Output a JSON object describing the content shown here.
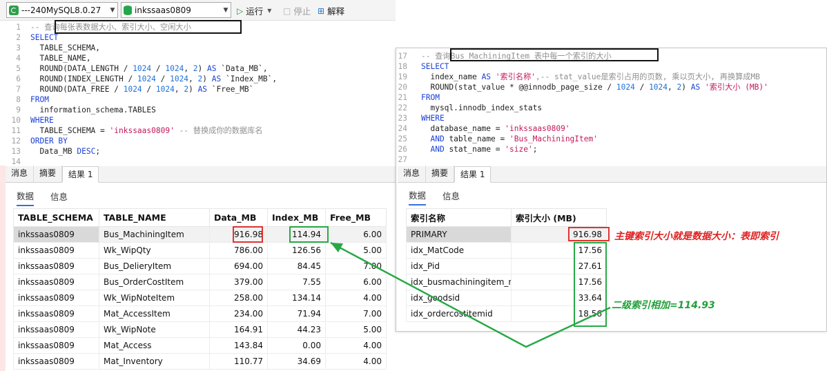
{
  "toolbar": {
    "connection": "---240MySQL8.0.27",
    "database": "inkssaas0809",
    "run_label": "运行",
    "stop_label": "停止",
    "explain_label": "解释"
  },
  "left_editor": {
    "lines": [
      {
        "n": "1",
        "segs": [
          {
            "t": "-- ",
            "c": "cm"
          },
          {
            "t": "查询每张表数据大小、索引大小、空闲大小",
            "c": "cm"
          }
        ]
      },
      {
        "n": "2",
        "segs": [
          {
            "t": "SELECT",
            "c": "kw"
          }
        ]
      },
      {
        "n": "3",
        "segs": [
          {
            "t": "  TABLE_SCHEMA,",
            "c": "tx"
          }
        ]
      },
      {
        "n": "4",
        "segs": [
          {
            "t": "  TABLE_NAME,",
            "c": "tx"
          }
        ]
      },
      {
        "n": "5",
        "segs": [
          {
            "t": "  ROUND(DATA_LENGTH / ",
            "c": "tx"
          },
          {
            "t": "1024",
            "c": "num"
          },
          {
            "t": " / ",
            "c": "tx"
          },
          {
            "t": "1024",
            "c": "num"
          },
          {
            "t": ", ",
            "c": "tx"
          },
          {
            "t": "2",
            "c": "num"
          },
          {
            "t": ") ",
            "c": "tx"
          },
          {
            "t": "AS",
            "c": "kw"
          },
          {
            "t": " `Data_MB`,",
            "c": "tx"
          }
        ]
      },
      {
        "n": "6",
        "segs": [
          {
            "t": "  ROUND(INDEX_LENGTH / ",
            "c": "tx"
          },
          {
            "t": "1024",
            "c": "num"
          },
          {
            "t": " / ",
            "c": "tx"
          },
          {
            "t": "1024",
            "c": "num"
          },
          {
            "t": ", ",
            "c": "tx"
          },
          {
            "t": "2",
            "c": "num"
          },
          {
            "t": ") ",
            "c": "tx"
          },
          {
            "t": "AS",
            "c": "kw"
          },
          {
            "t": " `Index_MB`,",
            "c": "tx"
          }
        ]
      },
      {
        "n": "7",
        "segs": [
          {
            "t": "  ROUND(DATA_FREE / ",
            "c": "tx"
          },
          {
            "t": "1024",
            "c": "num"
          },
          {
            "t": " / ",
            "c": "tx"
          },
          {
            "t": "1024",
            "c": "num"
          },
          {
            "t": ", ",
            "c": "tx"
          },
          {
            "t": "2",
            "c": "num"
          },
          {
            "t": ") ",
            "c": "tx"
          },
          {
            "t": "AS",
            "c": "kw"
          },
          {
            "t": " `Free_MB`",
            "c": "tx"
          }
        ]
      },
      {
        "n": "8",
        "segs": [
          {
            "t": "FROM",
            "c": "kw"
          }
        ]
      },
      {
        "n": "9",
        "segs": [
          {
            "t": "  information_schema.TABLES",
            "c": "tx"
          }
        ]
      },
      {
        "n": "10",
        "segs": [
          {
            "t": "WHERE",
            "c": "kw"
          }
        ]
      },
      {
        "n": "11",
        "segs": [
          {
            "t": "  TABLE_SCHEMA = ",
            "c": "tx"
          },
          {
            "t": "'inkssaas0809'",
            "c": "str"
          },
          {
            "t": " -- 替换成你的数据库名",
            "c": "cm"
          }
        ]
      },
      {
        "n": "12",
        "segs": [
          {
            "t": "ORDER BY",
            "c": "kw"
          }
        ]
      },
      {
        "n": "13",
        "segs": [
          {
            "t": "  Data_MB ",
            "c": "tx"
          },
          {
            "t": "DESC",
            "c": "kw"
          },
          {
            "t": ";",
            "c": "tx"
          }
        ]
      },
      {
        "n": "14",
        "segs": []
      }
    ]
  },
  "left_tabs": [
    "消息",
    "摘要",
    "结果 1"
  ],
  "left_subtabs": [
    "数据",
    "信息"
  ],
  "left_table": {
    "columns": [
      "TABLE_SCHEMA",
      "TABLE_NAME",
      "Data_MB",
      "Index_MB",
      "Free_MB"
    ],
    "rows": [
      [
        "inkssaas0809",
        "Bus_MachiningItem",
        "916.98",
        "114.94",
        "6.00"
      ],
      [
        "inkssaas0809",
        "Wk_WipQty",
        "786.00",
        "126.56",
        "5.00"
      ],
      [
        "inkssaas0809",
        "Bus_DelieryItem",
        "694.00",
        "84.45",
        "7.00"
      ],
      [
        "inkssaas0809",
        "Bus_OrderCostItem",
        "379.00",
        "7.55",
        "6.00"
      ],
      [
        "inkssaas0809",
        "Wk_WipNoteItem",
        "258.00",
        "134.14",
        "4.00"
      ],
      [
        "inkssaas0809",
        "Mat_AccessItem",
        "234.00",
        "71.94",
        "7.00"
      ],
      [
        "inkssaas0809",
        "Wk_WipNote",
        "164.91",
        "44.23",
        "5.00"
      ],
      [
        "inkssaas0809",
        "Mat_Access",
        "143.84",
        "0.00",
        "4.00"
      ],
      [
        "inkssaas0809",
        "Mat_Inventory",
        "110.77",
        "34.69",
        "4.00"
      ]
    ]
  },
  "right_editor": {
    "lines": [
      {
        "n": "17",
        "segs": [
          {
            "t": "-- ",
            "c": "cm"
          },
          {
            "t": "查询Bus_MachiningItem 表中每一个索引的大小",
            "c": "cm"
          }
        ]
      },
      {
        "n": "18",
        "segs": [
          {
            "t": "SELECT",
            "c": "kw"
          }
        ]
      },
      {
        "n": "19",
        "segs": [
          {
            "t": "  index_name ",
            "c": "tx"
          },
          {
            "t": "AS",
            "c": "kw"
          },
          {
            "t": " ",
            "c": "tx"
          },
          {
            "t": "'索引名称'",
            "c": "str"
          },
          {
            "t": ",-- stat_value是索引占用的页数, 乘以页大小, 再换算成MB",
            "c": "cm"
          }
        ]
      },
      {
        "n": "20",
        "segs": [
          {
            "t": "  ROUND(stat_value * @@innodb_page_size / ",
            "c": "tx"
          },
          {
            "t": "1024",
            "c": "num"
          },
          {
            "t": " / ",
            "c": "tx"
          },
          {
            "t": "1024",
            "c": "num"
          },
          {
            "t": ", ",
            "c": "tx"
          },
          {
            "t": "2",
            "c": "num"
          },
          {
            "t": ") ",
            "c": "tx"
          },
          {
            "t": "AS",
            "c": "kw"
          },
          {
            "t": " ",
            "c": "tx"
          },
          {
            "t": "'索引大小 (MB)'",
            "c": "str"
          }
        ]
      },
      {
        "n": "21",
        "segs": [
          {
            "t": "FROM",
            "c": "kw"
          }
        ]
      },
      {
        "n": "22",
        "segs": [
          {
            "t": "  mysql.innodb_index_stats",
            "c": "tx"
          }
        ]
      },
      {
        "n": "23",
        "segs": [
          {
            "t": "WHERE",
            "c": "kw"
          }
        ]
      },
      {
        "n": "24",
        "segs": [
          {
            "t": "  database_name = ",
            "c": "tx"
          },
          {
            "t": "'inkssaas0809'",
            "c": "str"
          }
        ]
      },
      {
        "n": "25",
        "segs": [
          {
            "t": "  ",
            "c": "tx"
          },
          {
            "t": "AND",
            "c": "kw"
          },
          {
            "t": " table_name = ",
            "c": "tx"
          },
          {
            "t": "'Bus_MachiningItem'",
            "c": "str"
          }
        ]
      },
      {
        "n": "26",
        "segs": [
          {
            "t": "  ",
            "c": "tx"
          },
          {
            "t": "AND",
            "c": "kw"
          },
          {
            "t": " stat_name = ",
            "c": "tx"
          },
          {
            "t": "'size'",
            "c": "str"
          },
          {
            "t": ";",
            "c": "tx"
          }
        ]
      },
      {
        "n": "27",
        "segs": []
      }
    ]
  },
  "right_tabs": [
    "消息",
    "摘要",
    "结果 1"
  ],
  "right_subtabs": [
    "数据",
    "信息"
  ],
  "right_table": {
    "columns": [
      "索引名称",
      "索引大小 (MB)"
    ],
    "rows": [
      [
        "PRIMARY",
        "916.98"
      ],
      [
        "idx_MatCode",
        "17.56"
      ],
      [
        "idx_Pid",
        "27.61"
      ],
      [
        "idx_busmachiningitem_m",
        "17.56"
      ],
      [
        "idx_goodsid",
        "33.64"
      ],
      [
        "idx_ordercostitemid",
        "18.56"
      ]
    ]
  },
  "annotations": {
    "primary_note": "主键索引大小就是数据大小：表即索引",
    "secondary_note": "二级索引相加=114.93"
  },
  "colors": {
    "red": "#e03232",
    "green": "#27a845",
    "keyword": "#1a3fd6",
    "string": "#c2185b"
  }
}
